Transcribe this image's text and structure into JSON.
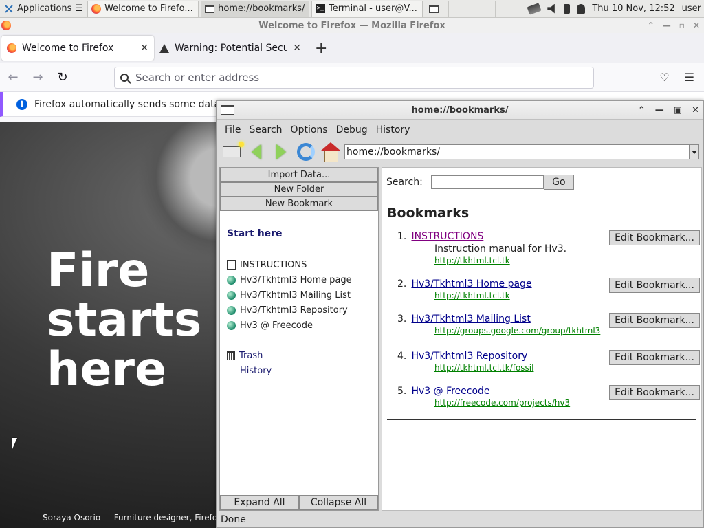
{
  "panel": {
    "applications_label": "Applications",
    "tasks": [
      {
        "label": "Welcome to Firefo..."
      },
      {
        "label": "home://bookmarks/"
      },
      {
        "label": "Terminal - user@V..."
      }
    ],
    "clock": "Thu 10 Nov, 12:52",
    "user": "user"
  },
  "firefox": {
    "window_title": "Welcome to Firefox — Mozilla Firefox",
    "tabs": [
      {
        "label": "Welcome to Firefox"
      },
      {
        "label": "Warning: Potential Securi"
      }
    ],
    "url_placeholder": "Search or enter address",
    "notification": "Firefox automatically sends some data to",
    "hero_lines": [
      "Fire",
      "starts",
      "here"
    ],
    "credit": "Soraya Osorio — Furniture designer, Firefox"
  },
  "hv3": {
    "window_title": "home://bookmarks/",
    "menus": [
      "File",
      "Search",
      "Options",
      "Debug",
      "History"
    ],
    "url": "home://bookmarks/",
    "left": {
      "buttons": [
        "Import Data...",
        "New Folder",
        "New Bookmark"
      ],
      "section_title": "Start here",
      "tree_items": [
        {
          "label": "INSTRUCTIONS",
          "icon": "document-icon"
        },
        {
          "label": "Hv3/Tkhtml3 Home page",
          "icon": "globe-icon"
        },
        {
          "label": "Hv3/Tkhtml3 Mailing List",
          "icon": "globe-icon"
        },
        {
          "label": "Hv3/Tkhtml3 Repository",
          "icon": "globe-icon"
        },
        {
          "label": "Hv3 @ Freecode",
          "icon": "globe-icon"
        }
      ],
      "trash_label": "Trash",
      "history_label": "History",
      "expand_all": "Expand All",
      "collapse_all": "Collapse All"
    },
    "right": {
      "search_label": "Search:",
      "go_label": "Go",
      "heading": "Bookmarks",
      "edit_label": "Edit Bookmark...",
      "bookmarks": [
        {
          "num": "1.",
          "title": "INSTRUCTIONS",
          "desc": "Instruction manual for Hv3.",
          "url": "http://tkhtml.tcl.tk",
          "visited": true
        },
        {
          "num": "2.",
          "title": "Hv3/Tkhtml3 Home page",
          "desc": "",
          "url": "http://tkhtml.tcl.tk",
          "visited": false
        },
        {
          "num": "3.",
          "title": "Hv3/Tkhtml3 Mailing List",
          "desc": "",
          "url": "http://groups.google.com/group/tkhtml3",
          "visited": false
        },
        {
          "num": "4.",
          "title": "Hv3/Tkhtml3 Repository",
          "desc": "",
          "url": "http://tkhtml.tcl.tk/fossil",
          "visited": false
        },
        {
          "num": "5.",
          "title": "Hv3 @ Freecode",
          "desc": "",
          "url": "http://freecode.com/projects/hv3",
          "visited": false
        }
      ]
    },
    "status": "Done"
  }
}
